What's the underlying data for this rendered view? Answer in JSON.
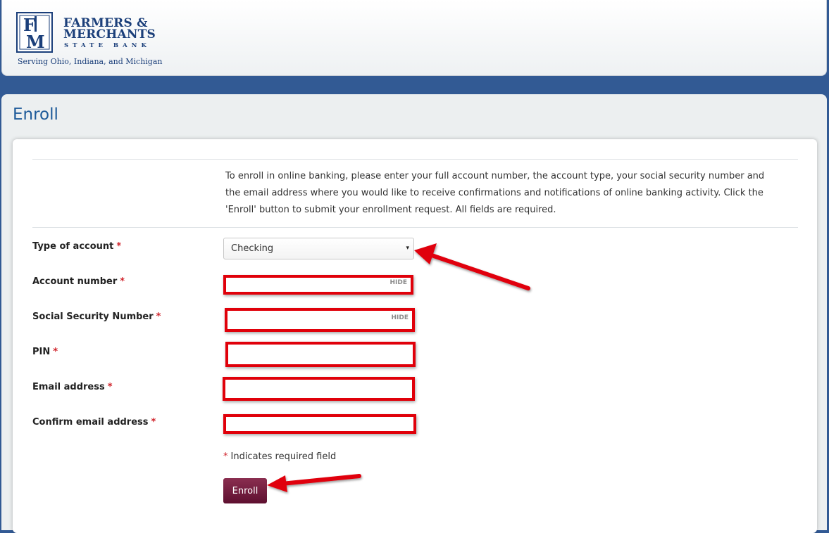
{
  "header": {
    "logo_letters": "FM",
    "bank_name_line1": "FARMERS &",
    "bank_name_line2": "MERCHANTS",
    "bank_name_line3": "STATE BANK",
    "tagline": "Serving Ohio, Indiana, and Michigan"
  },
  "page": {
    "title": "Enroll"
  },
  "intro": "To enroll in online banking, please enter your full account number, the account type, your social security number and the email address where you would like to receive confirmations and notifications of online banking activity. Click the 'Enroll' button to submit your enrollment request. All fields are required.",
  "form": {
    "required_marker": "*",
    "type_of_account": {
      "label": "Type of account",
      "value": "Checking"
    },
    "account_number": {
      "label": "Account number",
      "value": "",
      "toggle": "HIDE"
    },
    "ssn": {
      "label": "Social Security Number",
      "value": "",
      "toggle": "HIDE"
    },
    "pin": {
      "label": "PIN",
      "value": ""
    },
    "email": {
      "label": "Email address",
      "value": ""
    },
    "confirm_email": {
      "label": "Confirm email address",
      "value": ""
    },
    "required_note": "Indicates required field",
    "submit_label": "Enroll"
  },
  "colors": {
    "brand_blue": "#1b3f7a",
    "page_background": "#325a94",
    "highlight_red": "#e0000a",
    "button": "#6b1a3c"
  },
  "icons": {
    "select_caret": "▾",
    "annotation_arrows": "red-arrow-icon"
  }
}
